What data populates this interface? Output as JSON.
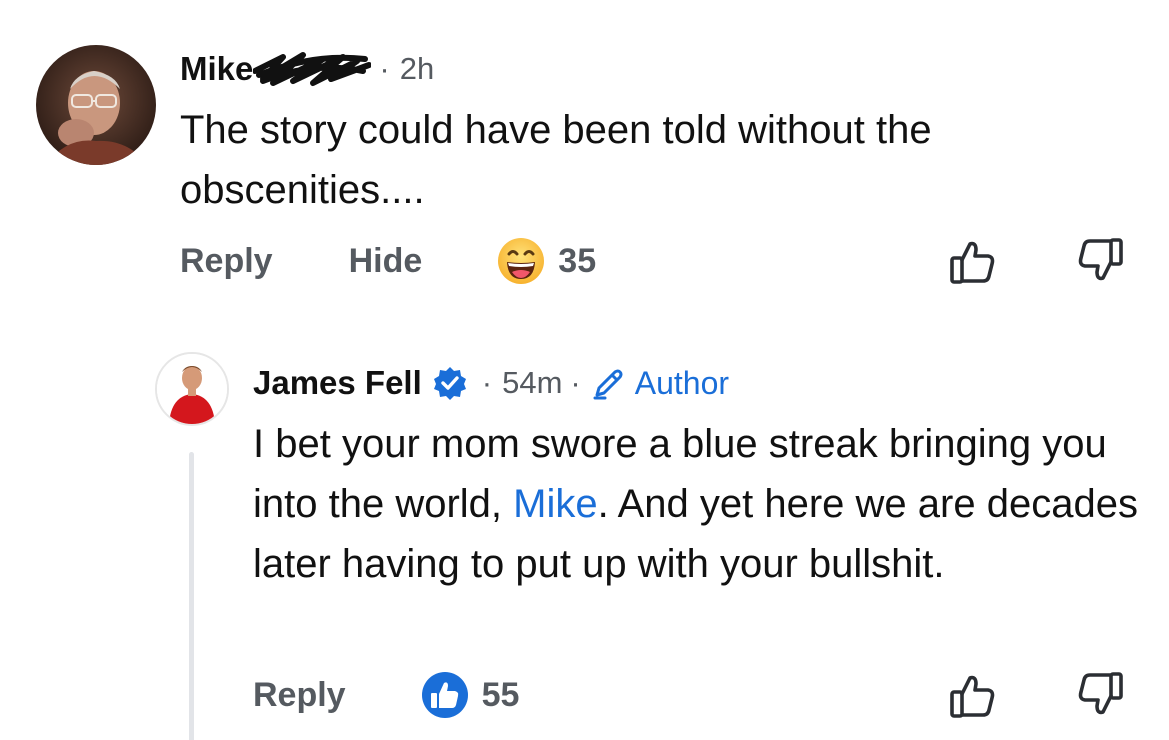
{
  "comments": [
    {
      "author": "Mike",
      "time": "2h",
      "text": "The story could have been told without the obscenities....",
      "actions": {
        "reply": "Reply",
        "hide": "Hide"
      },
      "reaction": {
        "icon": "laughing-emoji-icon",
        "count": "35"
      }
    }
  ],
  "reply": {
    "author": "James Fell",
    "time": "54m",
    "badge": "Author",
    "text_before": "I bet your mom swore a blue streak bringing you into the world, ",
    "mention": "Mike",
    "text_after": ". And yet here we are decades later having to put up with your bullshit.",
    "actions": {
      "reply": "Reply"
    },
    "reaction": {
      "icon": "thumbs-up-icon",
      "count": "55"
    }
  },
  "colors": {
    "accent": "#1a6ed8",
    "muted": "#555a60",
    "thread": "#e2e4e8"
  }
}
